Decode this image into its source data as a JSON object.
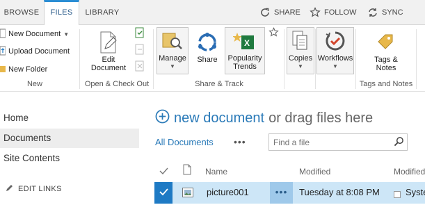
{
  "tabs": [
    {
      "label": "BROWSE"
    },
    {
      "label": "FILES"
    },
    {
      "label": "LIBRARY"
    }
  ],
  "top_actions": {
    "share": "SHARE",
    "follow": "FOLLOW",
    "sync": "SYNC"
  },
  "ribbon": {
    "new": {
      "new_document": "New Document",
      "upload_document": "Upload Document",
      "new_folder": "New Folder",
      "label": "New"
    },
    "open_checkout": {
      "edit_document_line1": "Edit",
      "edit_document_line2": "Document",
      "label": "Open & Check Out"
    },
    "share_track": {
      "manage": "Manage",
      "share": "Share",
      "popularity_line1": "Popularity",
      "popularity_line2": "Trends",
      "label": "Share & Track"
    },
    "copies": "Copies",
    "workflows": "Workflows",
    "tags": {
      "tags_line1": "Tags &",
      "tags_line2": "Notes",
      "label": "Tags and Notes"
    }
  },
  "nav": {
    "items": [
      {
        "label": "Home"
      },
      {
        "label": "Documents"
      },
      {
        "label": "Site Contents"
      }
    ],
    "edit_links": "EDIT LINKS"
  },
  "main": {
    "new_document_link": "new document",
    "drag_text": "or drag files here",
    "view_name": "All Documents",
    "ellipsis": "•••",
    "search_placeholder": "Find a file",
    "columns": {
      "name": "Name",
      "modified": "Modified",
      "modified_by": "Modified"
    },
    "rows": [
      {
        "name": "picture001",
        "modified": "Tuesday at 8:08 PM",
        "modified_by": "Syste"
      }
    ]
  },
  "colors": {
    "accent": "#2a7ab8",
    "selected_row": "#cde6f7",
    "check_blue": "#1e7ac4"
  }
}
